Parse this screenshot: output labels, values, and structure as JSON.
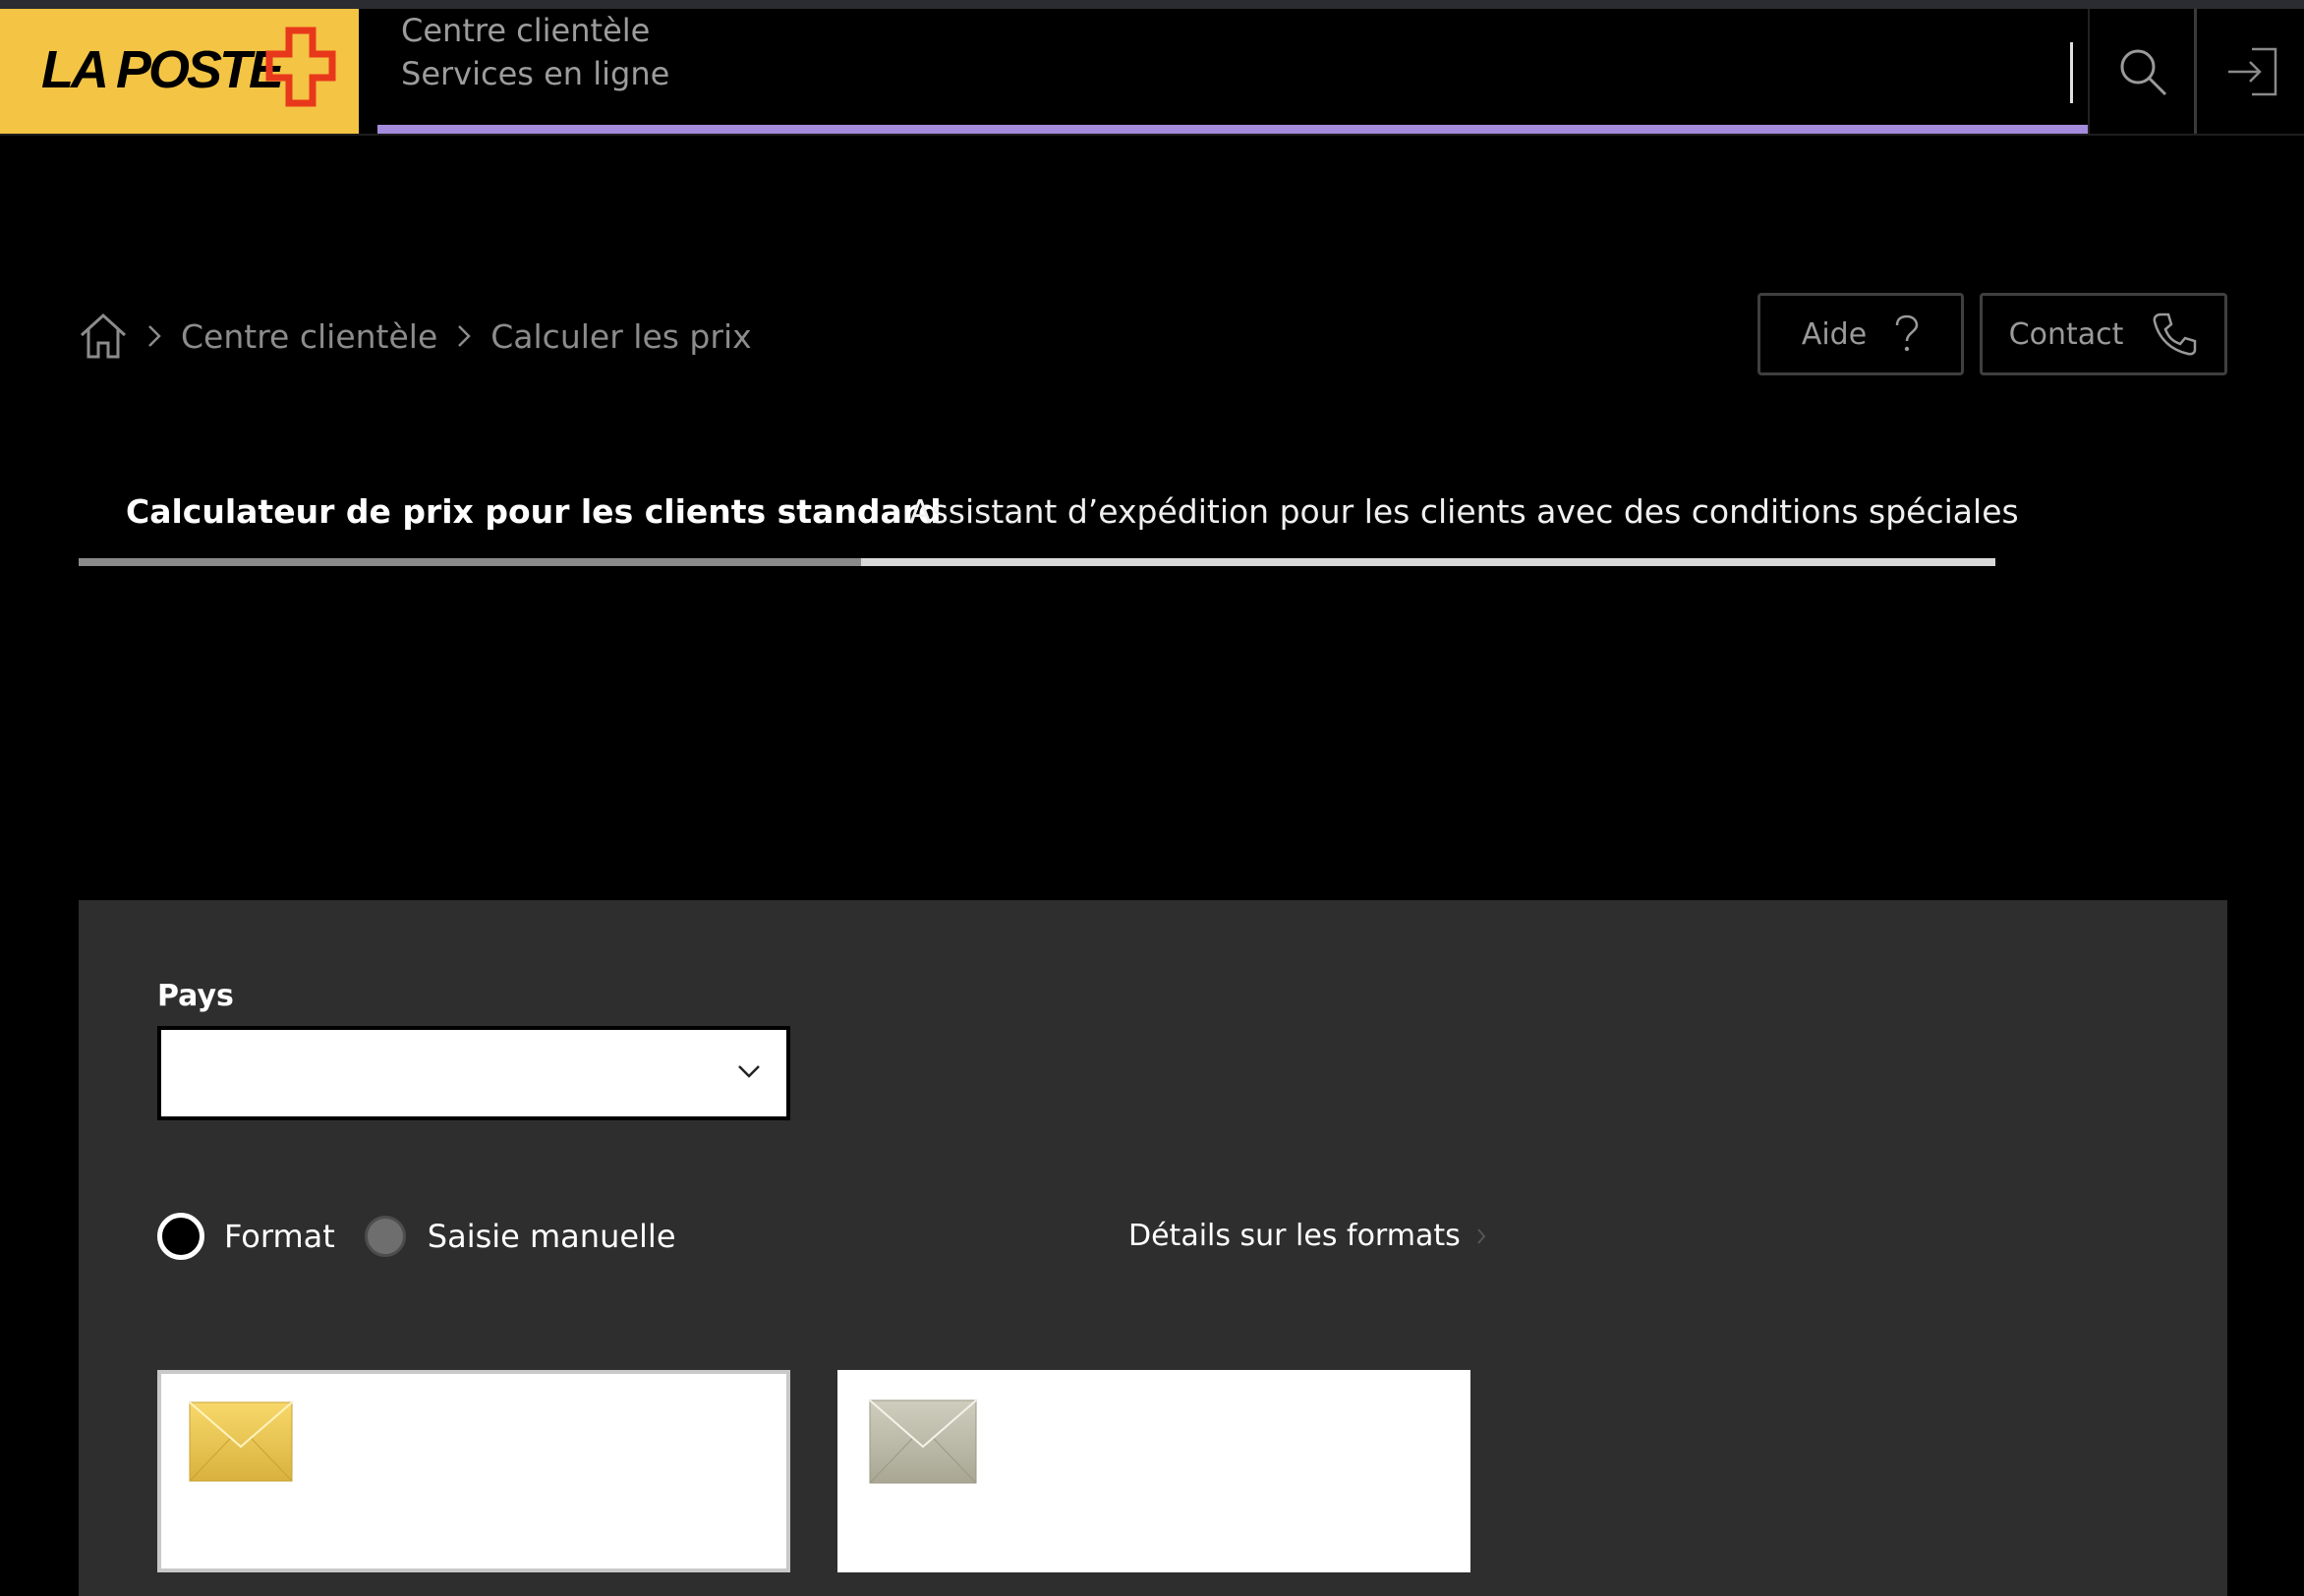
{
  "header": {
    "logo_text": "LA POSTE",
    "service_line1": "Centre clientèle",
    "service_line2": "Services en ligne",
    "search_icon": "search-icon",
    "login_icon": "login-icon",
    "progress_fraction": 1.0,
    "brand_color": "#f4c444",
    "accent_color": "#a48bdb"
  },
  "breadcrumb": {
    "home_icon": "home-icon",
    "items": [
      "Centre clientèle",
      "Calculer les prix"
    ]
  },
  "actions": {
    "help_label": "Aide",
    "contact_label": "Contact"
  },
  "tabs": [
    {
      "label": "Calculateur de prix pour les clients standard",
      "active": true
    },
    {
      "label": "Assistant d’expédition pour les clients avec des conditions spéciales",
      "active": false
    }
  ],
  "form": {
    "country_label": "Pays",
    "country_value": "",
    "radio_options": [
      {
        "label": "Format",
        "selected": true
      },
      {
        "label": "Saisie manuelle",
        "selected": false
      }
    ],
    "details_link": "Détails sur les formats",
    "cards": [
      {
        "icon": "letter-envelope-yellow-icon",
        "selected": true
      },
      {
        "icon": "letter-envelope-grey-icon",
        "selected": false
      }
    ]
  }
}
